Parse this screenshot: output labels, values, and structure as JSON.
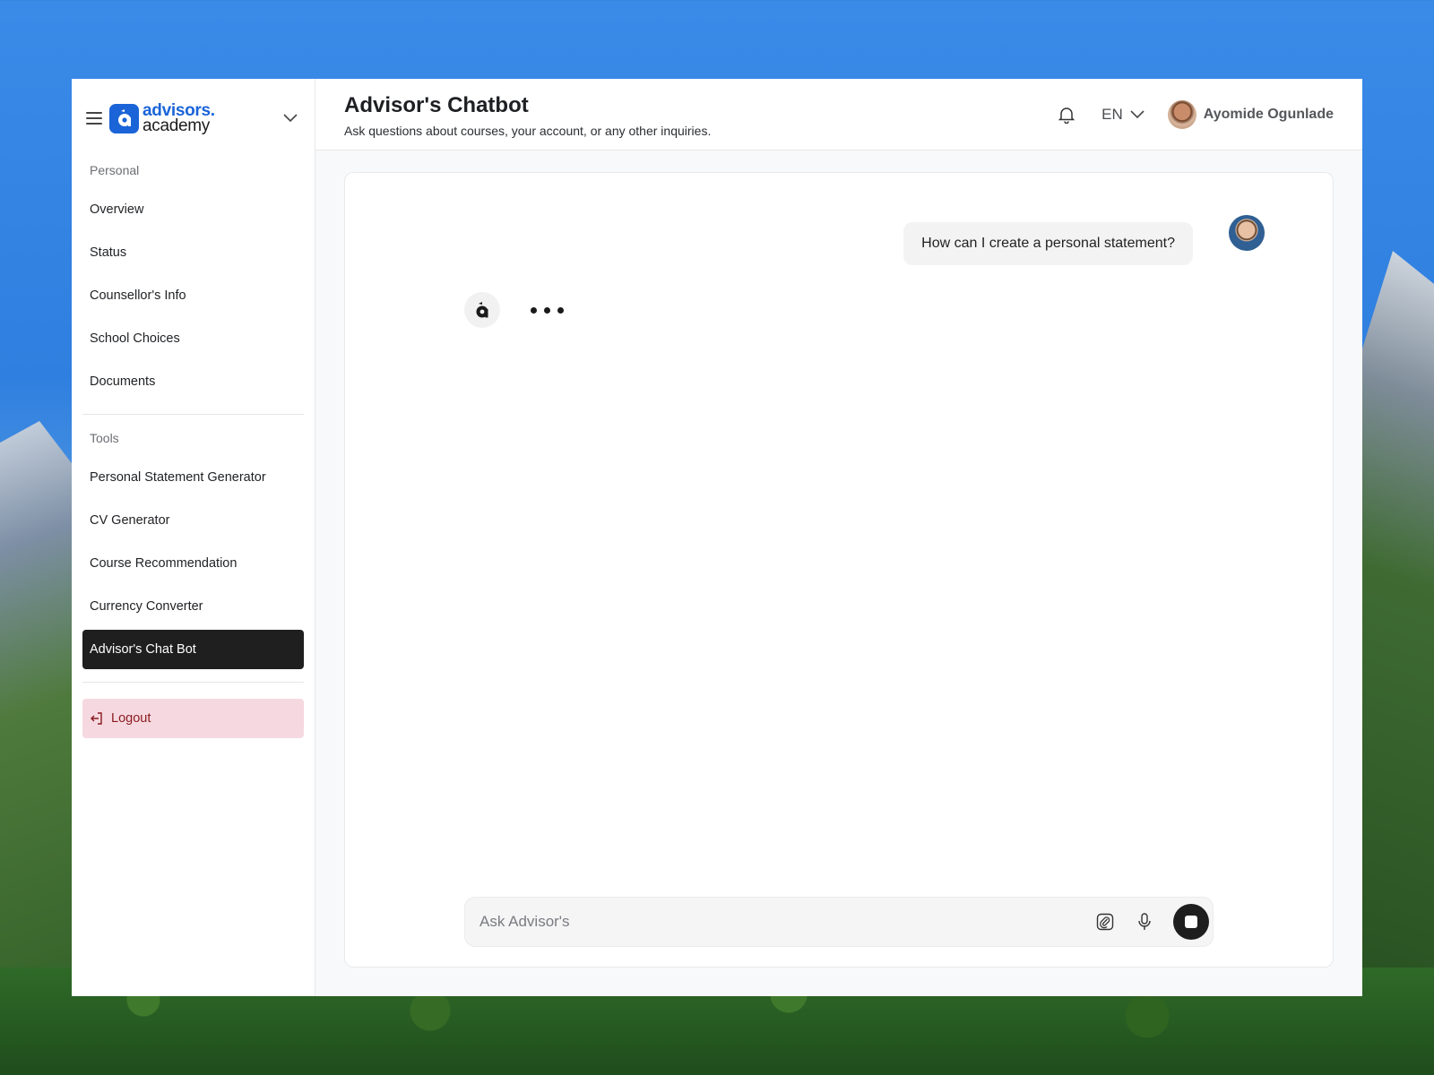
{
  "brand": {
    "line1": "advisors.",
    "line2": "academy"
  },
  "sidebar": {
    "sections": [
      {
        "label": "Personal",
        "items": [
          {
            "label": "Overview"
          },
          {
            "label": "Status"
          },
          {
            "label": "Counsellor's Info"
          },
          {
            "label": "School Choices"
          },
          {
            "label": "Documents"
          }
        ]
      },
      {
        "label": "Tools",
        "items": [
          {
            "label": "Personal Statement Generator"
          },
          {
            "label": "CV Generator"
          },
          {
            "label": "Course Recommendation"
          },
          {
            "label": "Currency Converter"
          },
          {
            "label": "Advisor's Chat Bot",
            "active": true
          }
        ]
      }
    ],
    "logout_label": "Logout"
  },
  "header": {
    "title": "Advisor's Chatbot",
    "subtitle": "Ask questions about courses, your account, or any other inquiries.",
    "language": "EN",
    "user_name": "Ayomide Ogunlade"
  },
  "chat": {
    "messages": [
      {
        "role": "user",
        "text": "How can I create a personal statement?"
      }
    ],
    "bot_typing": true
  },
  "composer": {
    "placeholder": "Ask Advisor's"
  },
  "colors": {
    "brand": "#1a64d8",
    "active_nav": "#1f1f1f",
    "logout_bg": "#f6d9e0",
    "logout_text": "#8a1a1f"
  }
}
